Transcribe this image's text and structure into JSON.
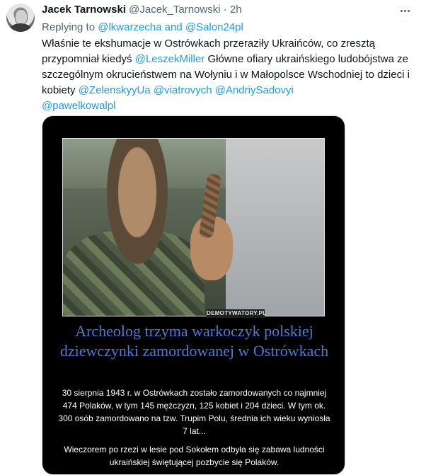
{
  "tweet": {
    "author_name": "Jacek Tarnowski",
    "author_handle": "@Jacek_Tarnowski",
    "separator": "·",
    "time": "2h",
    "replying_prefix": "Replying to ",
    "replying_to_1": "@lkwarzecha",
    "replying_and": " and ",
    "replying_to_2": "@Salon24pl",
    "text_part1": "Właśnie te ekshumacje w Ostrówkach przeraziły Ukraińców, co zresztą przypomniał kiedyś ",
    "mention_leszek": "@LeszekMiller",
    "text_part2": " Główne ofiary ukraińskiego ludobójstwa ze szczególnym okrucieństwem na Wołyniu i w Małopolsce Wschodniej to dzieci i kobiety ",
    "mention_zelensky": "@ZelenskyyUa",
    "mention_viatrovych": "@viatrovych",
    "mention_sadovyi": "@AndriySadovyi",
    "mention_kowal": "@pawelkowalpl"
  },
  "media": {
    "watermark": "DEMOTYWATORY.PL",
    "title": "Archeolog trzyma warkoczyk polskiej dziewczynki zamordowanej w Ostrówkach",
    "body1": "30 sierpnia 1943 r. w Ostrówkach zostało zamordowanych co najmniej 474 Polaków, w tym 145 mężczyzn, 125 kobiet i 204 dzieci. W tym ok. 300 osób zamordowano na tzw. Trupim Polu, średnia ich wieku wyniosła 7 lat...",
    "body2": "Wieczorem po rzezi w lesie pod Sokołem odbyła się zabawa ludności ukraińskiej świętującej pozbycie się Polaków."
  },
  "colors": {
    "link": "#1d9bf0",
    "caption_title": "#4a7bd6",
    "muted": "#536471"
  },
  "icons": {
    "more": "more-horizontal-icon"
  }
}
